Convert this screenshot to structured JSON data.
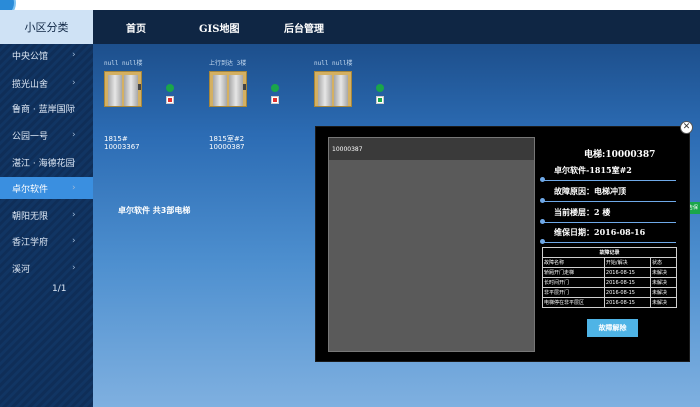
{
  "sidebar": {
    "title": "小区分类",
    "items": [
      {
        "label": "中央公馆",
        "chevron": "›"
      },
      {
        "label": "揽光山舍",
        "chevron": "›"
      },
      {
        "label": "鲁商 · 蓝岸国际",
        "chevron": "›"
      },
      {
        "label": "公园一号",
        "chevron": "›"
      },
      {
        "label": "湛江 · 海德花园",
        "chevron": "›"
      },
      {
        "label": "卓尔软件",
        "chevron": "›",
        "active": true
      },
      {
        "label": "朝阳无限",
        "chevron": "›"
      },
      {
        "label": "香江学府",
        "chevron": "›"
      },
      {
        "label": "溪河",
        "chevron": "›"
      }
    ],
    "pager": "1/1"
  },
  "nav": {
    "home": "首页",
    "gis": "GIS地图",
    "admin": "后台管理"
  },
  "elevators": [
    {
      "top_label": "null null楼",
      "name": "1815#",
      "code": "10003367"
    },
    {
      "top_label": "上行到达 3楼",
      "name": "1815室#2",
      "code": "10000387"
    },
    {
      "top_label": "null null楼",
      "name": "",
      "code": ""
    }
  ],
  "summary": "卓尔软件 共3部电梯",
  "right_badge": "告保",
  "popup": {
    "close_icon": "close-icon",
    "video_title": "10000387",
    "elevator_title": "电梯:10000387",
    "lines": [
      "卓尔软件-1815室#2",
      "故障原因：电梯冲顶",
      "当前楼层：2 楼",
      "维保日期：2016-08-16"
    ],
    "fault_table": {
      "caption": "故障记录",
      "headers": [
        "故障名称",
        "开始/解决",
        "状态"
      ],
      "rows": [
        [
          "轿厢开门走梯",
          "2016-08-15",
          "未解决"
        ],
        [
          "长时间开门",
          "2016-08-15",
          "未解决"
        ],
        [
          "非平层开门",
          "2016-08-15",
          "未解决"
        ],
        [
          "电梯停在非平层区",
          "2016-08-15",
          "未解决"
        ]
      ]
    },
    "clear_button": "故障解除"
  },
  "colors": {
    "topbar": "#0f2644",
    "sidebar_active": "#3a8fe0",
    "status_ok": "#1aa64a",
    "status_alert": "#e0302f",
    "clear_button": "#4fb4e6"
  }
}
